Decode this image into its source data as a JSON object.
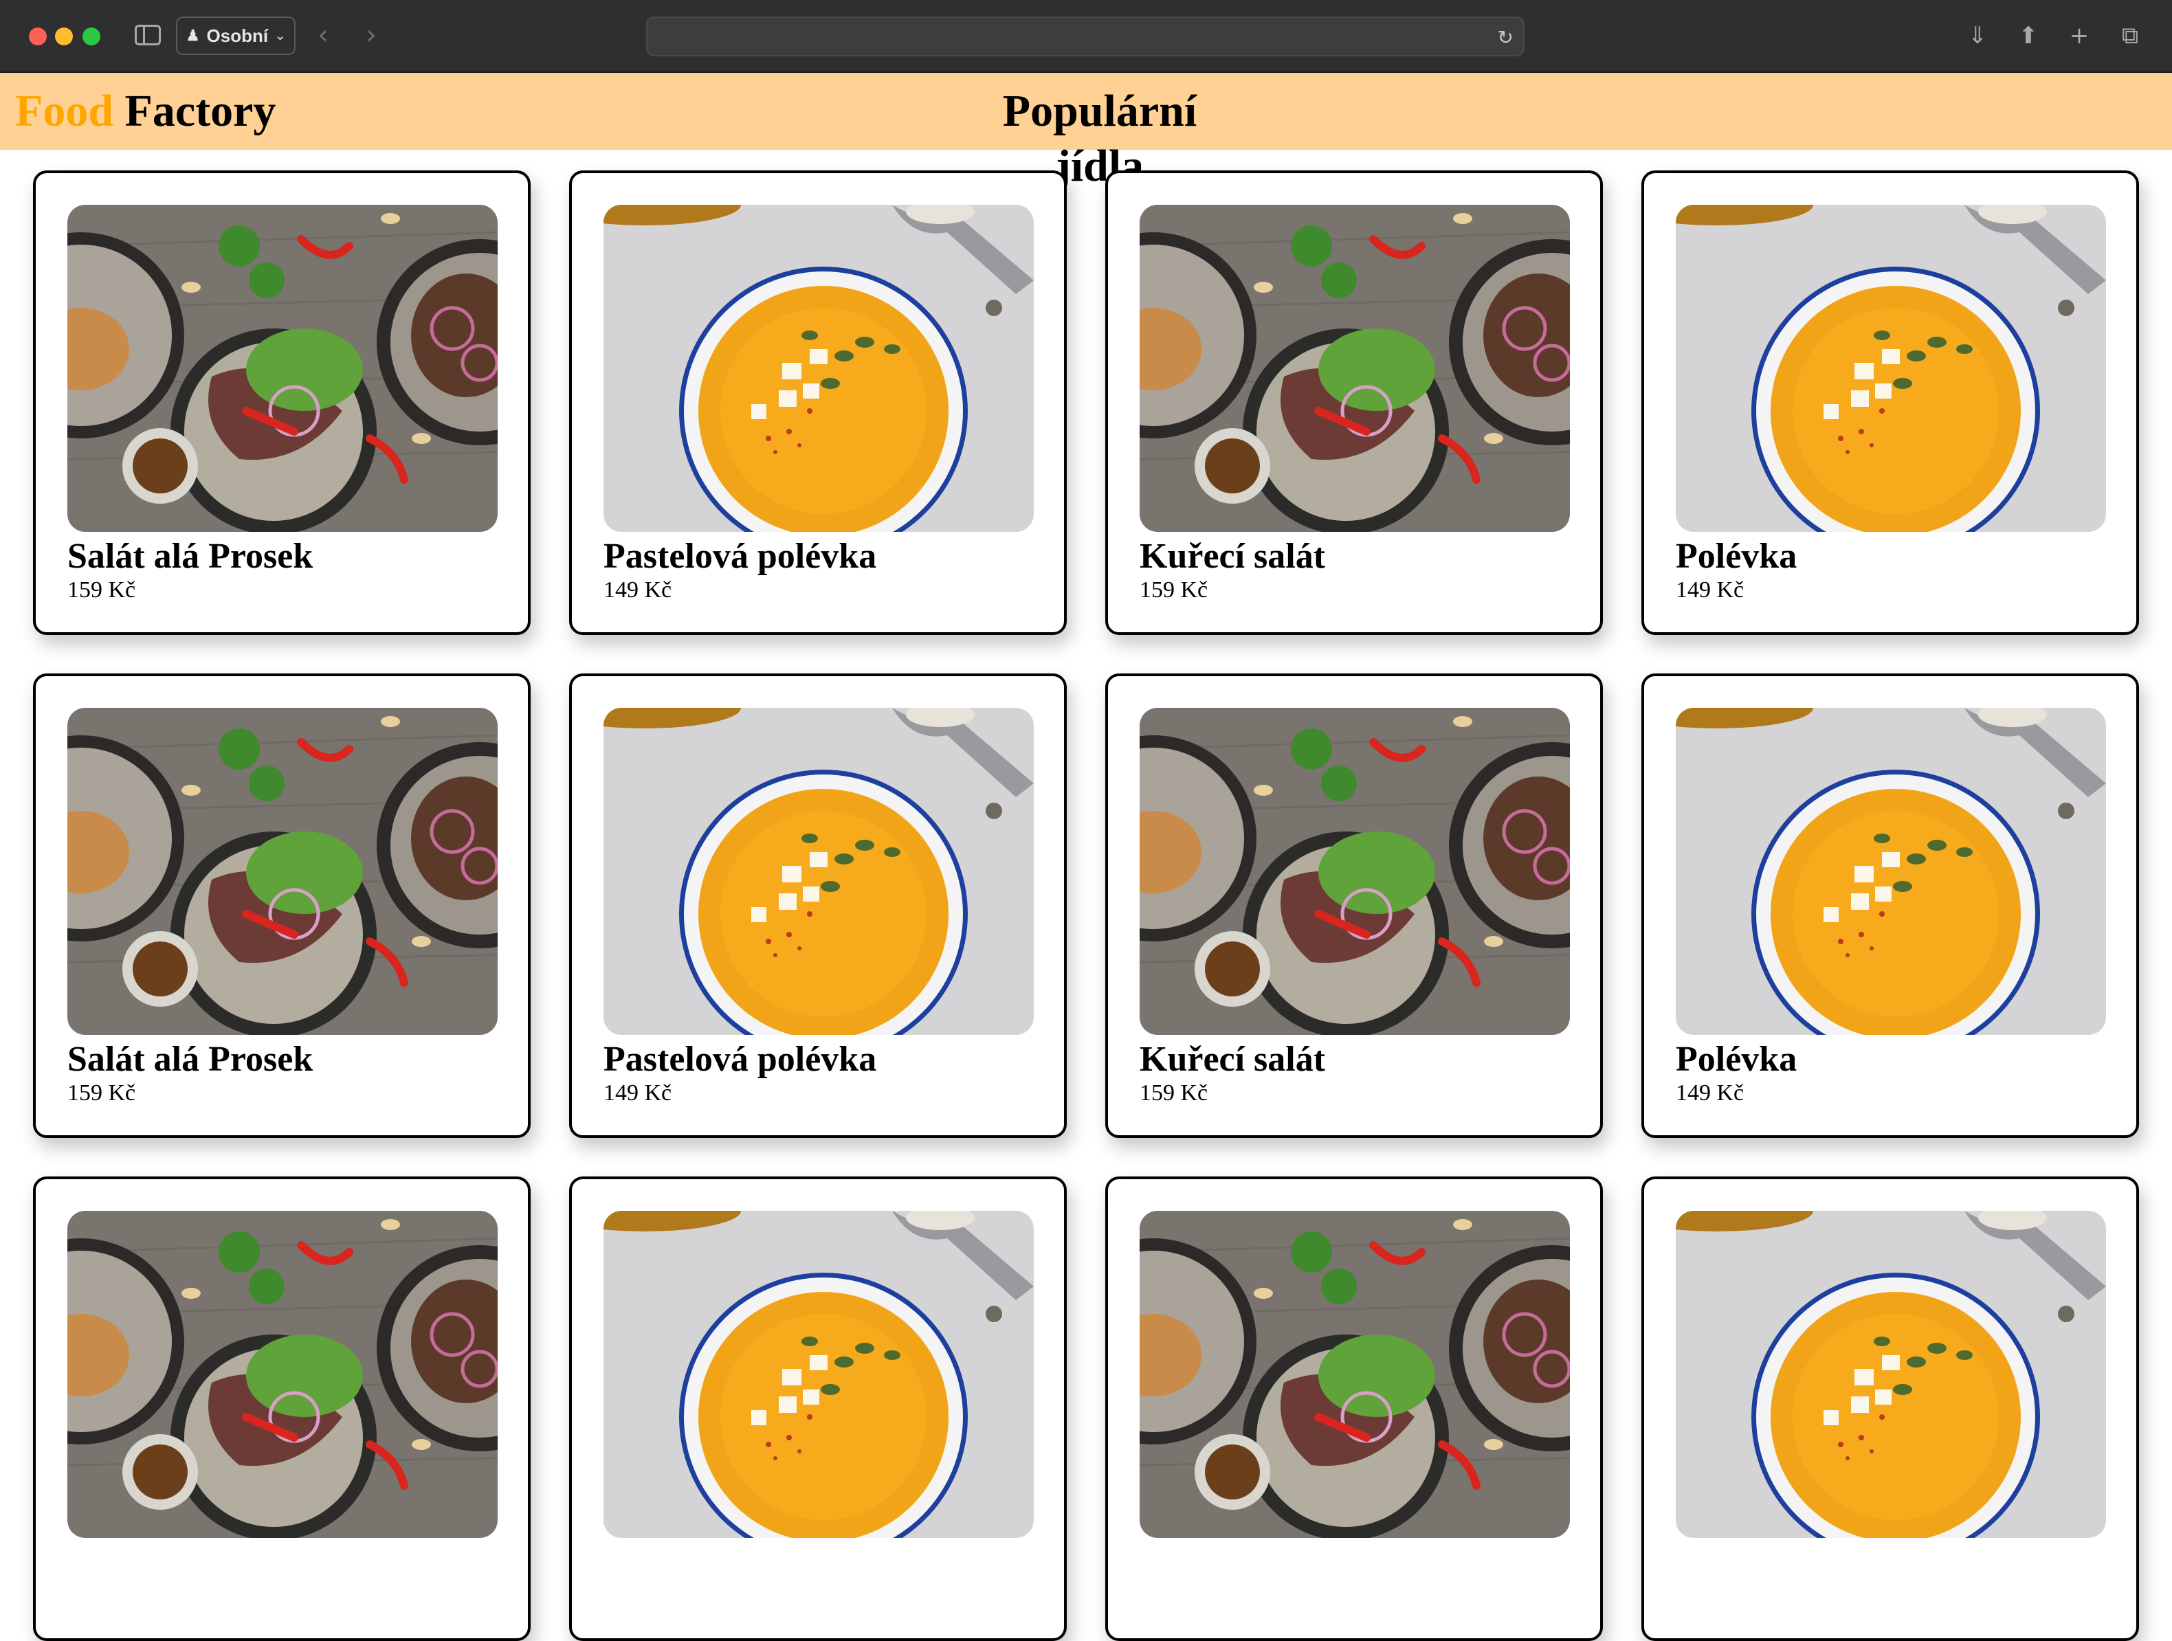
{
  "browser": {
    "profile_label": "Osobní",
    "url": ""
  },
  "header": {
    "logo_first": "Food",
    "logo_second": "Factory",
    "title": "Populární jídla"
  },
  "colors": {
    "header_bg": "#ffd194",
    "logo_accent": "#ffa500"
  },
  "menu": [
    {
      "name": "Salát alá Prosek",
      "price": "159 Kč",
      "image": "salad-icon"
    },
    {
      "name": "Pastelová polévka",
      "price": "149 Kč",
      "image": "soup-icon"
    },
    {
      "name": "Kuřecí salát",
      "price": "159 Kč",
      "image": "salad-icon"
    },
    {
      "name": "Polévka",
      "price": "149 Kč",
      "image": "soup-icon"
    },
    {
      "name": "Salát alá Prosek",
      "price": "159 Kč",
      "image": "salad-icon"
    },
    {
      "name": "Pastelová polévka",
      "price": "149 Kč",
      "image": "soup-icon"
    },
    {
      "name": "Kuřecí salát",
      "price": "159 Kč",
      "image": "salad-icon"
    },
    {
      "name": "Polévka",
      "price": "149 Kč",
      "image": "soup-icon"
    },
    {
      "name": "",
      "price": "",
      "image": "salad-icon"
    },
    {
      "name": "",
      "price": "",
      "image": "soup-icon"
    },
    {
      "name": "",
      "price": "",
      "image": "salad-icon"
    },
    {
      "name": "",
      "price": "",
      "image": "soup-icon"
    }
  ]
}
